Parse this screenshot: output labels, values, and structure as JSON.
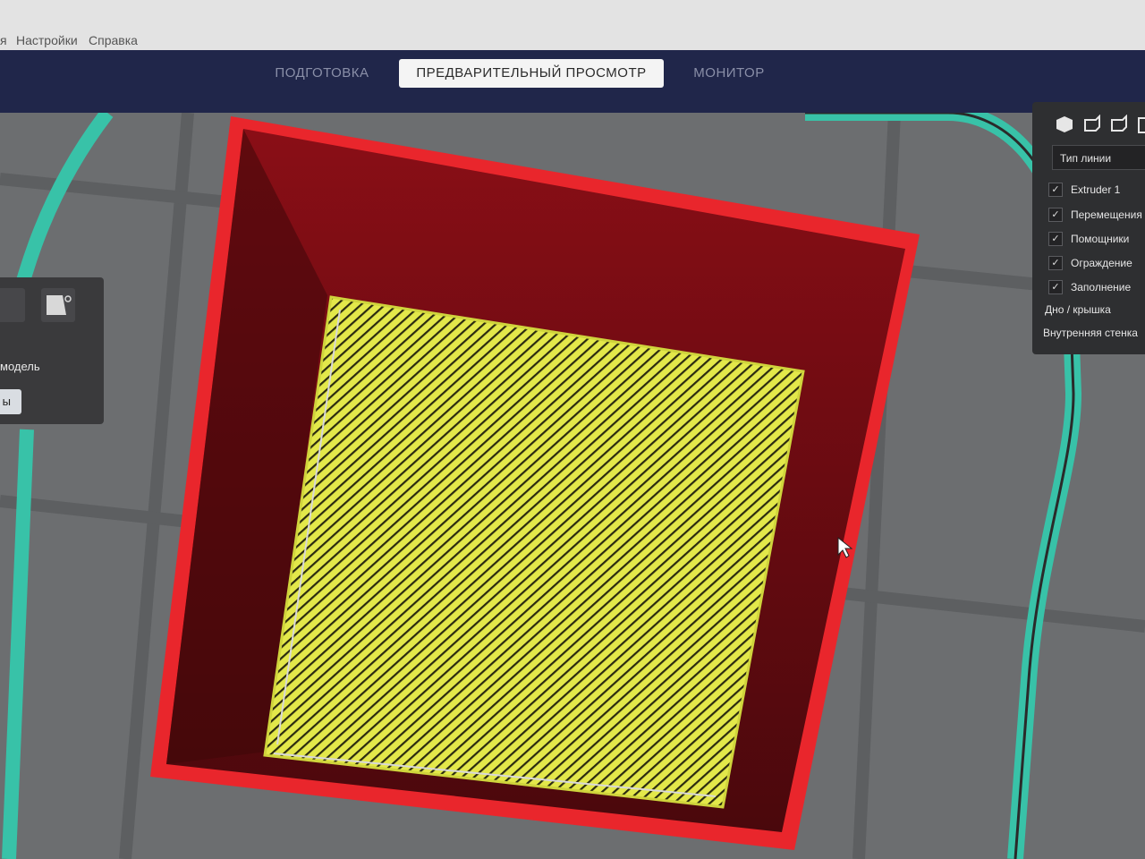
{
  "menu": {
    "items": [
      "я",
      "Настройки",
      "Справка"
    ]
  },
  "stages": {
    "tabs": [
      {
        "label": "ПОДГОТОВКА",
        "active": false
      },
      {
        "label": "ПРЕДВАРИТЕЛЬНЫЙ ПРОСМОТР",
        "active": true
      },
      {
        "label": "МОНИТОР",
        "active": false
      }
    ]
  },
  "left_panel": {
    "label": "модель",
    "button_label": "ы"
  },
  "view_panel": {
    "combo_value": "Тип линии",
    "checkboxes": [
      {
        "label": "Extruder 1",
        "checked": true
      },
      {
        "label": "Перемещения",
        "checked": true
      },
      {
        "label": "Помощники",
        "checked": true
      },
      {
        "label": "Ограждение",
        "checked": true
      },
      {
        "label": "Заполнение",
        "checked": true
      }
    ],
    "extra_labels": [
      "Дно / крышка",
      "Внутренняя стенка"
    ]
  },
  "colors": {
    "skirt": "#38c2a8",
    "outer_wall": "#e9262c",
    "wall_dark": "#5a0a0e",
    "top_bottom": "#e3e84a",
    "topbar": "#20264a"
  }
}
